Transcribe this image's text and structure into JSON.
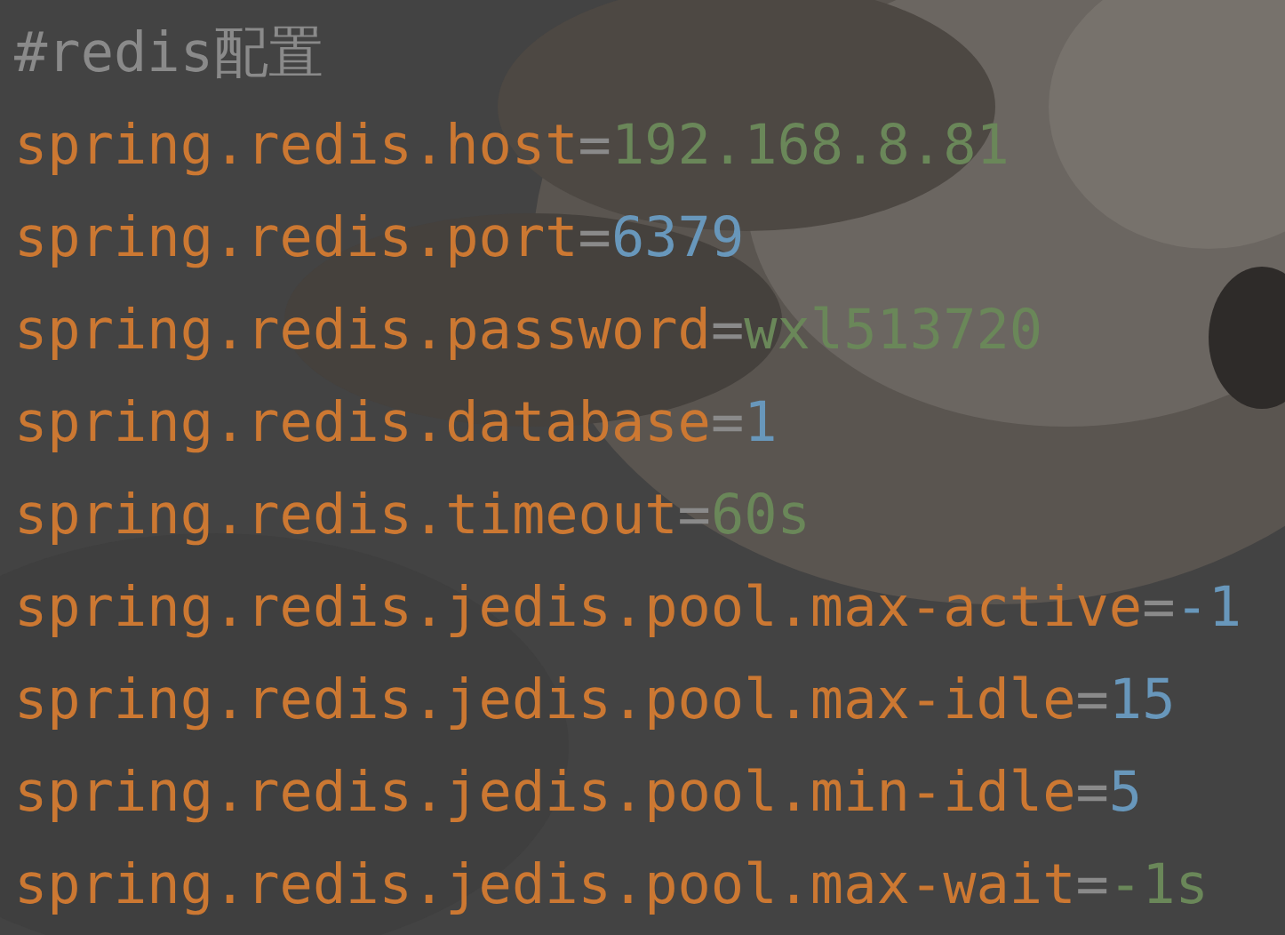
{
  "lines": [
    {
      "kind": "comment",
      "text": "#redis配置"
    },
    {
      "kind": "property",
      "key": "spring.redis.host",
      "separator": "=",
      "value": {
        "kind": "string",
        "text": "192.168.8.81"
      }
    },
    {
      "kind": "property",
      "key": "spring.redis.port",
      "separator": "=",
      "value": {
        "kind": "number",
        "text": "6379"
      }
    },
    {
      "kind": "property",
      "key": "spring.redis.password",
      "separator": "=",
      "value": {
        "kind": "string",
        "text": "wxl513720"
      }
    },
    {
      "kind": "property",
      "key": "spring.redis.database",
      "separator": "=",
      "value": {
        "kind": "number",
        "text": "1"
      }
    },
    {
      "kind": "property",
      "key": "spring.redis.timeout",
      "separator": "=",
      "value": {
        "kind": "string",
        "text": "60s"
      }
    },
    {
      "kind": "property",
      "key": "spring.redis.jedis.pool.max-active",
      "separator": "=",
      "value": {
        "kind": "number",
        "text": "-1"
      }
    },
    {
      "kind": "property",
      "key": "spring.redis.jedis.pool.max-idle",
      "separator": "=",
      "value": {
        "kind": "number",
        "text": "15"
      }
    },
    {
      "kind": "property",
      "key": "spring.redis.jedis.pool.min-idle",
      "separator": "=",
      "value": {
        "kind": "number",
        "text": "5"
      }
    },
    {
      "kind": "property",
      "key": "spring.redis.jedis.pool.max-wait",
      "separator": "=",
      "value": {
        "kind": "string",
        "text": "-1s"
      }
    }
  ]
}
